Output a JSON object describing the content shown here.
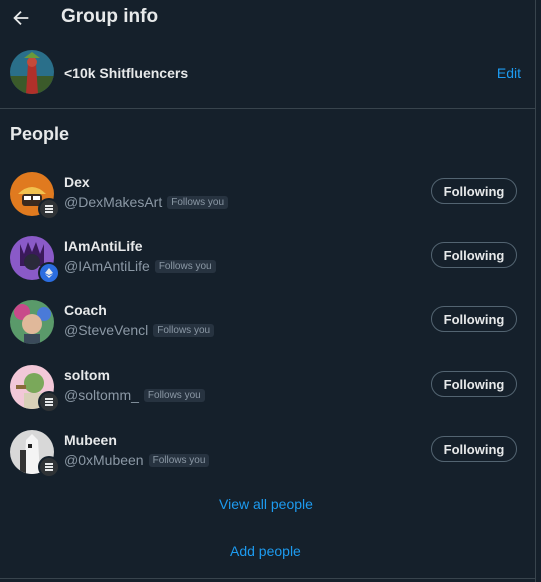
{
  "header": {
    "title": "Group info"
  },
  "group": {
    "name": "<10k Shitfluencers",
    "edit_label": "Edit"
  },
  "people": {
    "heading": "People",
    "members": [
      {
        "name": "Dex",
        "handle": "@DexMakesArt",
        "follows_you": "Follows you",
        "button": "Following",
        "badge_icon": "solana-icon"
      },
      {
        "name": "IAmAntiLife",
        "handle": "@IAmAntiLife",
        "follows_you": "Follows you",
        "button": "Following",
        "badge_icon": "ethereum-icon"
      },
      {
        "name": "Coach",
        "handle": "@SteveVencl",
        "follows_you": "Follows you",
        "button": "Following",
        "badge_icon": "none"
      },
      {
        "name": "soltom",
        "handle": "@soltomm_",
        "follows_you": "Follows you",
        "button": "Following",
        "badge_icon": "solana-icon"
      },
      {
        "name": "Mubeen",
        "handle": "@0xMubeen",
        "follows_you": "Follows you",
        "button": "Following",
        "badge_icon": "solana-icon"
      }
    ],
    "view_all_label": "View all people",
    "add_label": "Add people"
  },
  "colors": {
    "background": "#15202b",
    "accent": "#1d9bf0",
    "text": "#e7e9ea",
    "muted": "#8b98a5"
  }
}
